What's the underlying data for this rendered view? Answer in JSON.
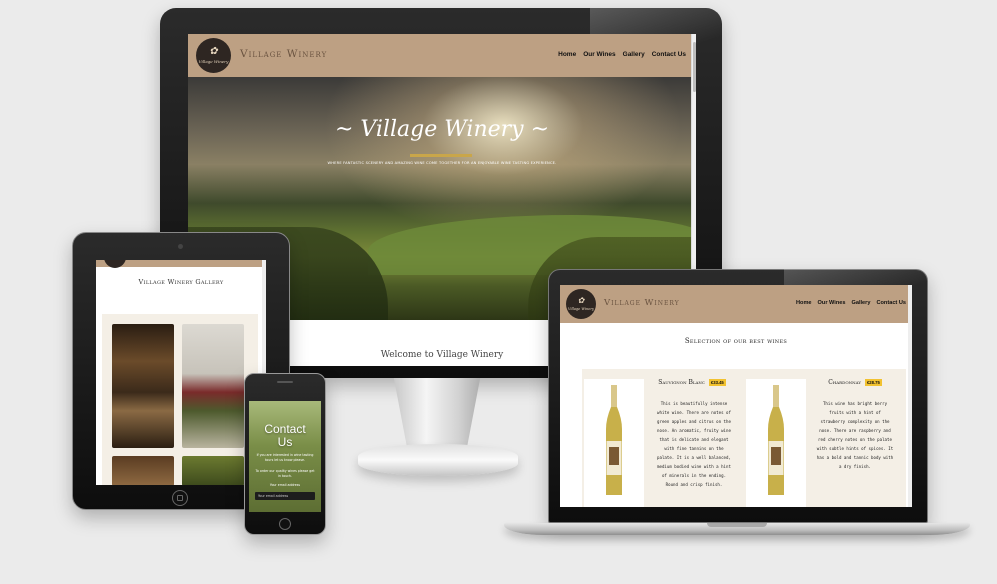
{
  "site": {
    "brand": "Village Winery",
    "logo_text": "Village Winery",
    "nav": [
      "Home",
      "Our Wines",
      "Gallery",
      "Contact Us"
    ],
    "hero_title": "~ Village Winery ~",
    "hero_tagline": "Where fantastic scenery and amazing wine come together for an enjoyable wine tasting experience.",
    "hero_below_text": "Welcome to Village Winery"
  },
  "tablet": {
    "gallery_title": "Village Winery Gallery"
  },
  "phone": {
    "contact_title": "Contact Us",
    "contact_text": "If you are interested in wine tasting tours let us know please.",
    "order_text": "To order our quality wines please get in touch.",
    "email_label": "Your email address",
    "email_placeholder": "Your email address"
  },
  "laptop": {
    "section_title": "Selection of our best wines",
    "wines": [
      {
        "name": "Sauvignon Blanc",
        "price": "€33.45",
        "description": "This is beautifully intense white wine. There are notes of green apples and citrus on the nose. An aromatic, fruity wine that is delicate and elegant with fine tannins on the palate. It is a well balanced, medium bodied wine with a hint of minerals in the ending. Round and crisp finish."
      },
      {
        "name": "Chardonnay",
        "price": "€28.75",
        "description": "This wine has bright berry fruits with a hint of strawberry complexity on the nose. There are raspberry and red cherry notes on the palate with subtle hints of spices. It has a bold and tannic body with a dry finish."
      }
    ]
  },
  "colors": {
    "nav_bg": "#bda083",
    "logo_bg": "#2e2622",
    "price_badge": "#f2c230",
    "accent_gold": "#c9a64a",
    "page_bg": "#ebebeb"
  }
}
